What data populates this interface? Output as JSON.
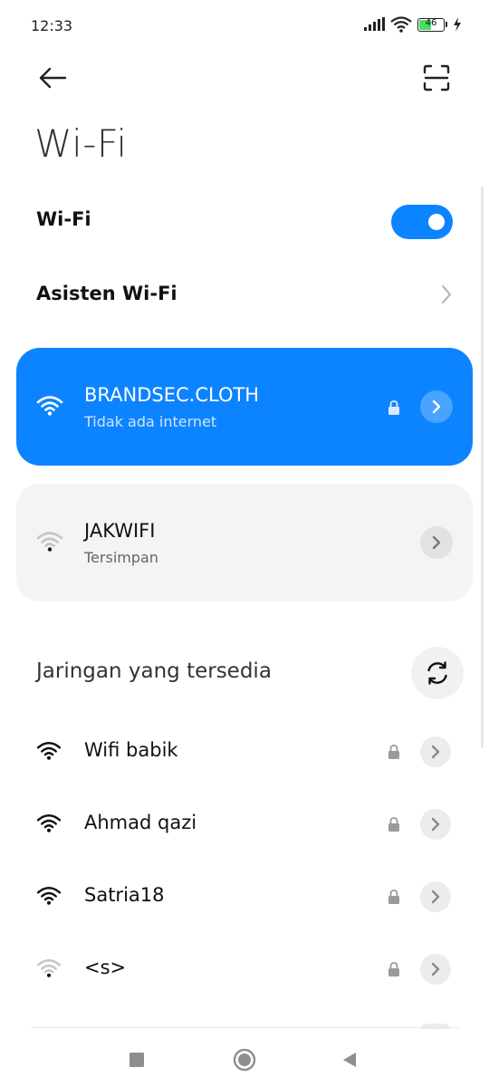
{
  "status_bar": {
    "time": "12:33",
    "battery_level": "46",
    "icons": [
      "signal-icon",
      "wifi-icon",
      "battery-icon",
      "charging-icon"
    ]
  },
  "header": {
    "back_icon": "back-arrow-icon",
    "scan_icon": "qr-scan-icon",
    "title": "Wi-Fi"
  },
  "settings": {
    "wifi_label": "Wi-Fi",
    "wifi_enabled": true,
    "assistant_label": "Asisten Wi-Fi"
  },
  "connected_network": {
    "name": "BRANDSEC.CLOTH",
    "status": "Tidak ada internet",
    "secured": true
  },
  "saved_network": {
    "name": "JAKWIFI",
    "status": "Tersimpan",
    "secured": false
  },
  "available": {
    "title": "Jaringan yang tersedia",
    "networks": [
      {
        "name": "Wifi babik",
        "secured": true,
        "signal": 4
      },
      {
        "name": "Ahmad qazi",
        "secured": true,
        "signal": 4
      },
      {
        "name": "Satria18",
        "secured": true,
        "signal": 4
      },
      {
        "name": "<s>",
        "secured": true,
        "signal": 1
      }
    ]
  },
  "nav": {
    "items": [
      "recents-square-icon",
      "home-circle-icon",
      "back-triangle-icon"
    ]
  },
  "colors": {
    "accent": "#0d84ff",
    "card_gray": "#f4f4f4",
    "text": "#111111"
  }
}
